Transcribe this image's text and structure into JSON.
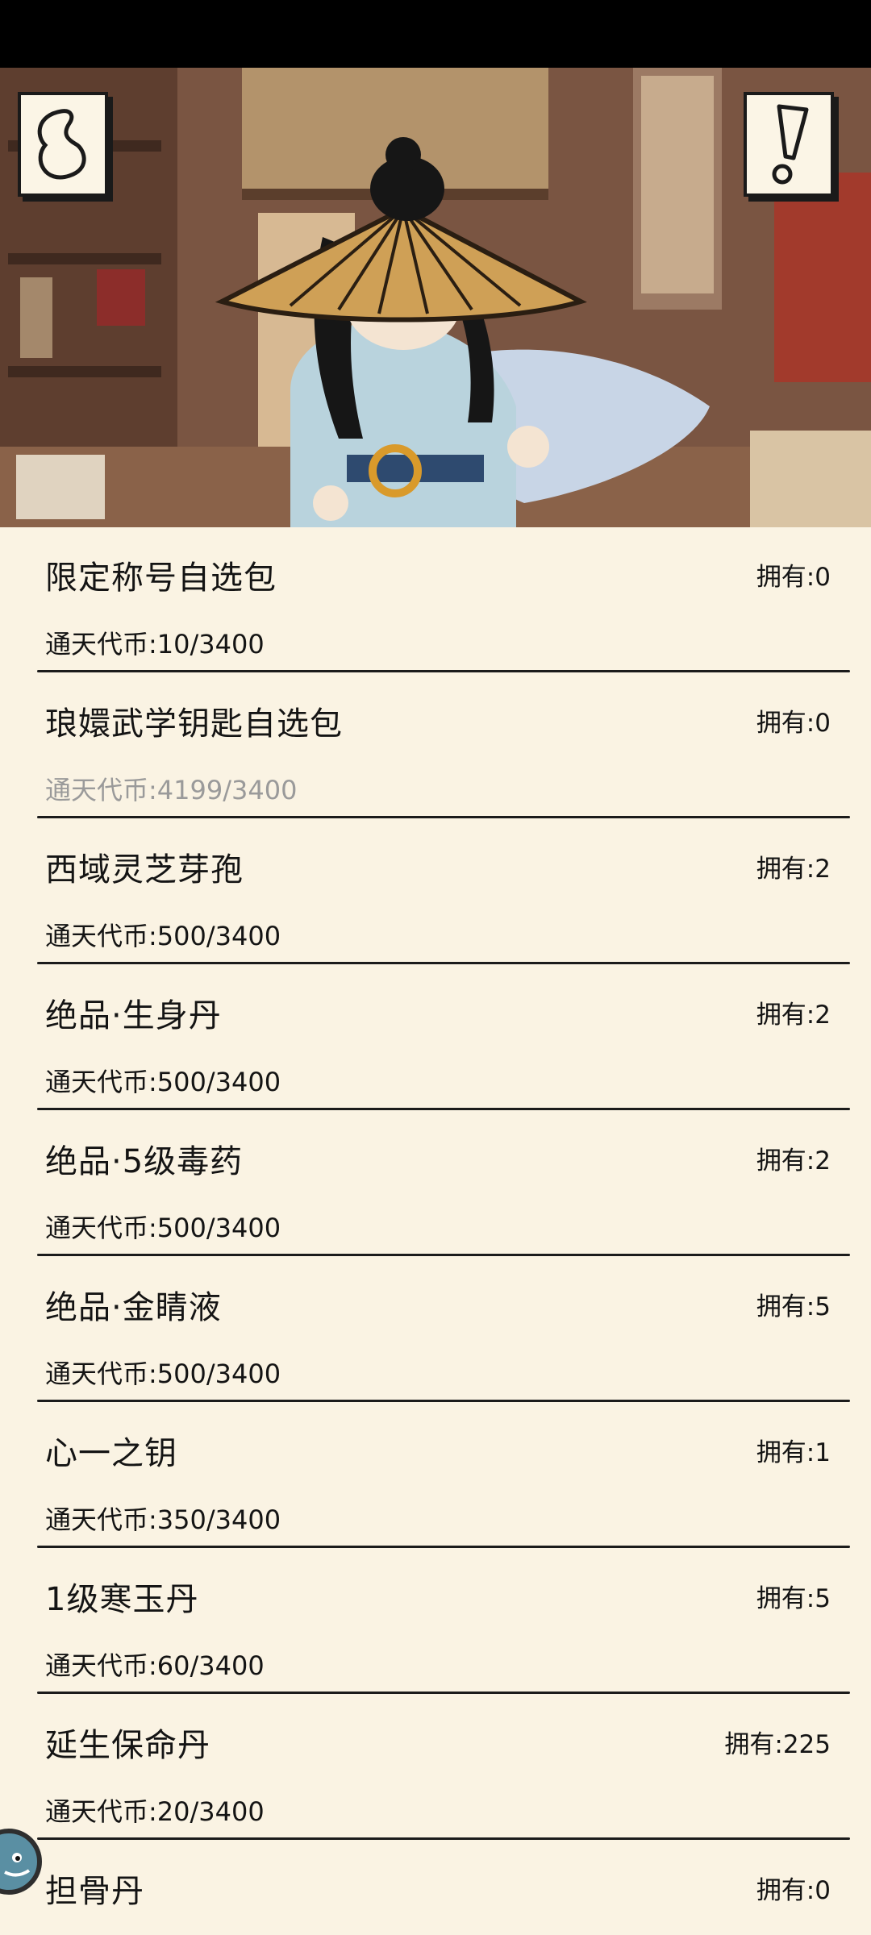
{
  "cost_label": "通天代币:",
  "owned_label": "拥有:",
  "items": [
    {
      "name": "限定称号自选包",
      "owned": "0",
      "cost": "10/3400",
      "affordable": true
    },
    {
      "name": "琅嬛武学钥匙自选包",
      "owned": "0",
      "cost": "4199/3400",
      "affordable": false
    },
    {
      "name": "西域灵芝芽孢",
      "owned": "2",
      "cost": "500/3400",
      "affordable": true
    },
    {
      "name": "绝品·生身丹",
      "owned": "2",
      "cost": "500/3400",
      "affordable": true
    },
    {
      "name": "绝品·5级毒药",
      "owned": "2",
      "cost": "500/3400",
      "affordable": true
    },
    {
      "name": "绝品·金睛液",
      "owned": "5",
      "cost": "500/3400",
      "affordable": true
    },
    {
      "name": "心一之钥",
      "owned": "1",
      "cost": "350/3400",
      "affordable": true
    },
    {
      "name": "1级寒玉丹",
      "owned": "5",
      "cost": "60/3400",
      "affordable": true
    },
    {
      "name": "延生保命丹",
      "owned": "225",
      "cost": "20/3400",
      "affordable": true
    },
    {
      "name": "担骨丹",
      "owned": "0",
      "cost": "",
      "affordable": true
    }
  ],
  "colors": {
    "panel": "#faf3e3",
    "text": "#141414",
    "dim_text": "#9a9a9a",
    "divider": "#1b1b1b"
  },
  "icons": {
    "back": "back-swirl-icon",
    "info": "exclamation-icon"
  }
}
